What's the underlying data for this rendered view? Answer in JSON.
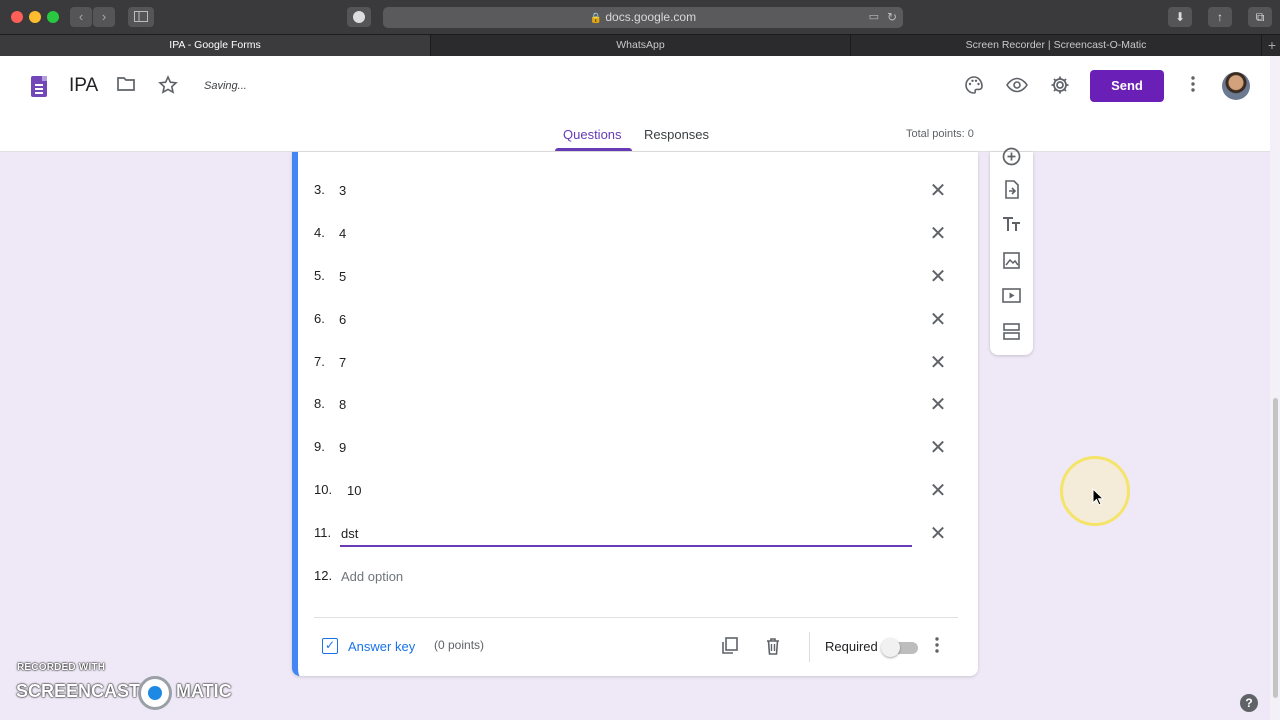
{
  "browser": {
    "url": "docs.google.com",
    "tabs": [
      {
        "label": "IPA - Google Forms",
        "active": true
      },
      {
        "label": "WhatsApp",
        "active": false
      },
      {
        "label": "Screen Recorder | Screencast-O-Matic",
        "active": false
      }
    ],
    "new_tab_label": "+"
  },
  "header": {
    "doc_title": "IPA",
    "status": "Saving...",
    "send_label": "Send",
    "accent": "#673ab7"
  },
  "form_tabs": {
    "questions": "Questions",
    "responses": "Responses",
    "active": "Questions",
    "total_points": "Total points: 0"
  },
  "question": {
    "options": [
      {
        "num": "3.",
        "text": "3"
      },
      {
        "num": "4.",
        "text": "4"
      },
      {
        "num": "5.",
        "text": "5"
      },
      {
        "num": "6.",
        "text": "6"
      },
      {
        "num": "7.",
        "text": "7"
      },
      {
        "num": "8.",
        "text": "8"
      },
      {
        "num": "9.",
        "text": "9"
      },
      {
        "num": "10.",
        "text": "10"
      },
      {
        "num": "11.",
        "text": "dst"
      }
    ],
    "add_option_num": "12.",
    "add_option_label": "Add option",
    "answer_key_label": "Answer key",
    "points_label": "(0 points)",
    "required_label": "Required",
    "required_on": false
  },
  "help_label": "?",
  "watermark": {
    "recorded_with": "RECORDED WITH",
    "brand_left": "SCREENCAST",
    "brand_right": "MATIC"
  }
}
